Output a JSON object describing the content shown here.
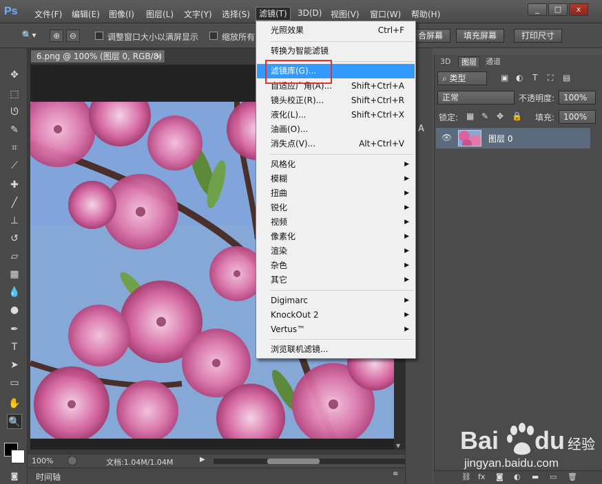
{
  "app": {
    "logo": "Ps"
  },
  "menu_bar": {
    "items": [
      "文件(F)",
      "编辑(E)",
      "图像(I)",
      "图层(L)",
      "文字(Y)",
      "选择(S)",
      "滤镜(T)",
      "3D(D)",
      "视图(V)",
      "窗口(W)",
      "帮助(H)"
    ],
    "active_index": 6,
    "window_controls": [
      "_",
      "□",
      "x"
    ]
  },
  "options_bar": {
    "checkbox1_label": "调整窗口大小以满屏显示",
    "checkbox2_label": "缩放所有",
    "fit_screen": "合屏幕",
    "fill_screen": "填充屏幕",
    "print_size": "打印尺寸"
  },
  "document": {
    "tab_title": "6.png @ 100% (图层 0, RGB/8)",
    "tab_close": "×",
    "zoom": "100%",
    "doc_info": "文档:1.04M/1.04M",
    "timeline_label": "时间轴"
  },
  "filter_menu": {
    "items": [
      {
        "label": "光照效果",
        "shortcut": "Ctrl+F"
      },
      {
        "label": "转换为智能滤镜",
        "shortcut": ""
      },
      {
        "label": "滤镜库(G)...",
        "shortcut": "",
        "highlighted": true
      },
      {
        "label": "自适应广角(A)...",
        "shortcut": "Shift+Ctrl+A"
      },
      {
        "label": "镜头校正(R)...",
        "shortcut": "Shift+Ctrl+R"
      },
      {
        "label": "液化(L)...",
        "shortcut": "Shift+Ctrl+X"
      },
      {
        "label": "油画(O)...",
        "shortcut": ""
      },
      {
        "label": "消失点(V)...",
        "shortcut": "Alt+Ctrl+V"
      },
      {
        "label": "风格化",
        "submenu": true
      },
      {
        "label": "模糊",
        "submenu": true
      },
      {
        "label": "扭曲",
        "submenu": true
      },
      {
        "label": "锐化",
        "submenu": true
      },
      {
        "label": "视频",
        "submenu": true
      },
      {
        "label": "像素化",
        "submenu": true
      },
      {
        "label": "渲染",
        "submenu": true
      },
      {
        "label": "杂色",
        "submenu": true
      },
      {
        "label": "其它",
        "submenu": true
      },
      {
        "label": "Digimarc",
        "submenu": true
      },
      {
        "label": "KnockOut 2",
        "submenu": true
      },
      {
        "label": "Vertus™",
        "submenu": true
      },
      {
        "label": "浏览联机滤镜...",
        "shortcut": ""
      }
    ]
  },
  "layers_panel": {
    "tabs": [
      "3D",
      "图层",
      "通道"
    ],
    "active_tab": 1,
    "kind_filter": "类型",
    "blend_mode": "正常",
    "opacity_label": "不透明度:",
    "opacity_value": "100%",
    "lock_label": "锁定:",
    "fill_label": "填充:",
    "fill_value": "100%",
    "layer_name": "图层 0"
  },
  "watermark": {
    "brand": "Bai",
    "brand2": "du",
    "suffix": "经验",
    "url": "jingyan.baidu.com"
  },
  "colors": {
    "highlight": "#3399ff",
    "red_box": "#e0332b",
    "sky": "#7fa3d4",
    "blossom": "#d9639e"
  }
}
